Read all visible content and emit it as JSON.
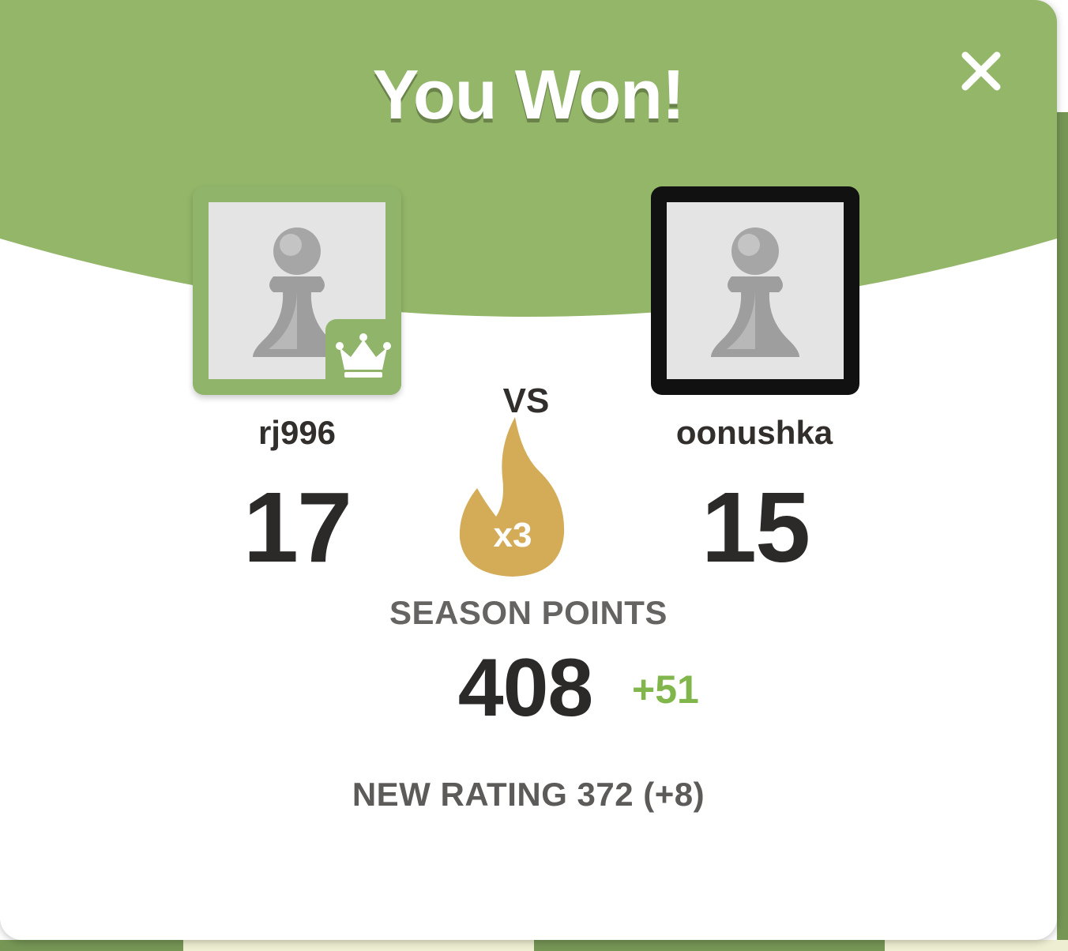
{
  "modal": {
    "title": "You Won!",
    "close_icon": "close-icon"
  },
  "colors": {
    "header_green": "#93b669",
    "accent_green": "#81b64c",
    "flame_gold": "#d4ac58",
    "text_dark": "#2b2a28",
    "text_muted": "#666463"
  },
  "players": {
    "me": {
      "username": "rj996",
      "score": "17",
      "avatar_icon": "pawn-icon",
      "badge_icon": "crown-icon"
    },
    "opponent": {
      "username": "oonushka",
      "score": "15",
      "avatar_icon": "pawn-icon"
    }
  },
  "versus": {
    "label": "VS",
    "streak_icon": "flame-icon",
    "streak_multiplier": "x3"
  },
  "season": {
    "label": "SEASON POINTS",
    "points": "408",
    "delta": "+51"
  },
  "rating": {
    "text": "NEW RATING 372 (+8)"
  }
}
